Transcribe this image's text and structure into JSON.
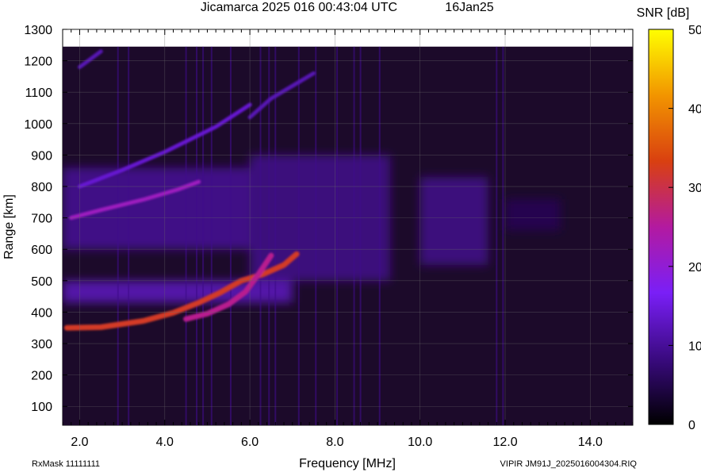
{
  "title": "Jicamarca 2025 016 00:43:04 UTC",
  "date_label": "16Jan25",
  "footer_left": "RxMask 11111111",
  "footer_right": "VIPIR  JM91J_2025016004304.RIQ",
  "chart_data": {
    "type": "heatmap",
    "title": "Jicamarca 2025 016 00:43:04 UTC",
    "xlabel": "Frequency [MHz]",
    "ylabel": "Range [km]",
    "xlim": [
      1.6,
      15.0
    ],
    "ylim": [
      40,
      1300
    ],
    "xticks": [
      2.0,
      4.0,
      6.0,
      8.0,
      10.0,
      12.0,
      14.0
    ],
    "xtick_labels": [
      "2.0",
      "4.0",
      "6.0",
      "8.0",
      "10.0",
      "12.0",
      "14.0"
    ],
    "yticks": [
      100,
      200,
      300,
      400,
      500,
      600,
      700,
      800,
      900,
      1000,
      1100,
      1200,
      1300
    ],
    "ytick_labels": [
      "100",
      "200",
      "300",
      "400",
      "500",
      "600",
      "700",
      "800",
      "900",
      "1000",
      "1100",
      "1200",
      "1300"
    ],
    "data_range_top_km": 1245,
    "grid": true,
    "colorbar": {
      "label": "SNR [dB]",
      "min": 0,
      "max": 50,
      "ticks": [
        0,
        10,
        20,
        30,
        40,
        50
      ],
      "tick_labels": [
        "0",
        "10",
        "20",
        "30",
        "40",
        "50"
      ],
      "colors": [
        "#000000",
        "#3a0a80",
        "#7a1ff7",
        "#b31aa0",
        "#d94010",
        "#f29500",
        "#ffff00"
      ]
    },
    "background_color": "#1c0a2a",
    "echo_traces": [
      {
        "name": "O-trace",
        "snr_db": 32,
        "points": [
          [
            1.7,
            350
          ],
          [
            2.5,
            352
          ],
          [
            3.5,
            372
          ],
          [
            4.2,
            398
          ],
          [
            4.8,
            430
          ],
          [
            5.3,
            462
          ],
          [
            5.8,
            500
          ],
          [
            6.3,
            520
          ],
          [
            6.8,
            550
          ],
          [
            7.1,
            585
          ]
        ]
      },
      {
        "name": "X-trace",
        "snr_db": 26,
        "points": [
          [
            4.5,
            378
          ],
          [
            5.0,
            395
          ],
          [
            5.5,
            425
          ],
          [
            5.9,
            465
          ],
          [
            6.2,
            520
          ],
          [
            6.5,
            580
          ]
        ]
      },
      {
        "name": "second-hop",
        "snr_db": 22,
        "points": [
          [
            1.8,
            700
          ],
          [
            2.5,
            725
          ],
          [
            3.5,
            758
          ],
          [
            4.3,
            790
          ],
          [
            4.8,
            815
          ]
        ]
      },
      {
        "name": "second-hop-x",
        "snr_db": 14,
        "points": [
          [
            2.0,
            800
          ],
          [
            3.0,
            852
          ],
          [
            4.0,
            910
          ],
          [
            5.2,
            990
          ],
          [
            6.0,
            1060
          ]
        ]
      },
      {
        "name": "third-hop",
        "snr_db": 12,
        "points": [
          [
            2.0,
            1180
          ],
          [
            2.5,
            1230
          ]
        ]
      },
      {
        "name": "third-hop-x",
        "snr_db": 12,
        "points": [
          [
            6.0,
            1020
          ],
          [
            6.5,
            1080
          ],
          [
            7.0,
            1120
          ],
          [
            7.5,
            1160
          ]
        ]
      }
    ],
    "spread_regions": [
      {
        "x": [
          1.6,
          7.0
        ],
        "y": [
          430,
          500
        ],
        "snr_db": 14
      },
      {
        "x": [
          1.6,
          6.0
        ],
        "y": [
          600,
          860
        ],
        "snr_db": 11
      },
      {
        "x": [
          6.0,
          9.3
        ],
        "y": [
          500,
          900
        ],
        "snr_db": 10
      },
      {
        "x": [
          10.0,
          11.6
        ],
        "y": [
          550,
          830
        ],
        "snr_db": 10
      },
      {
        "x": [
          12.0,
          13.3
        ],
        "y": [
          660,
          760
        ],
        "snr_db": 6
      }
    ],
    "interference_lines_mhz": [
      2.9,
      3.15,
      4.5,
      4.75,
      4.9,
      5.1,
      5.55,
      6.25,
      6.45,
      6.6,
      7.15,
      7.55,
      8.05,
      8.45,
      8.6,
      9.05,
      11.8,
      11.95
    ]
  }
}
